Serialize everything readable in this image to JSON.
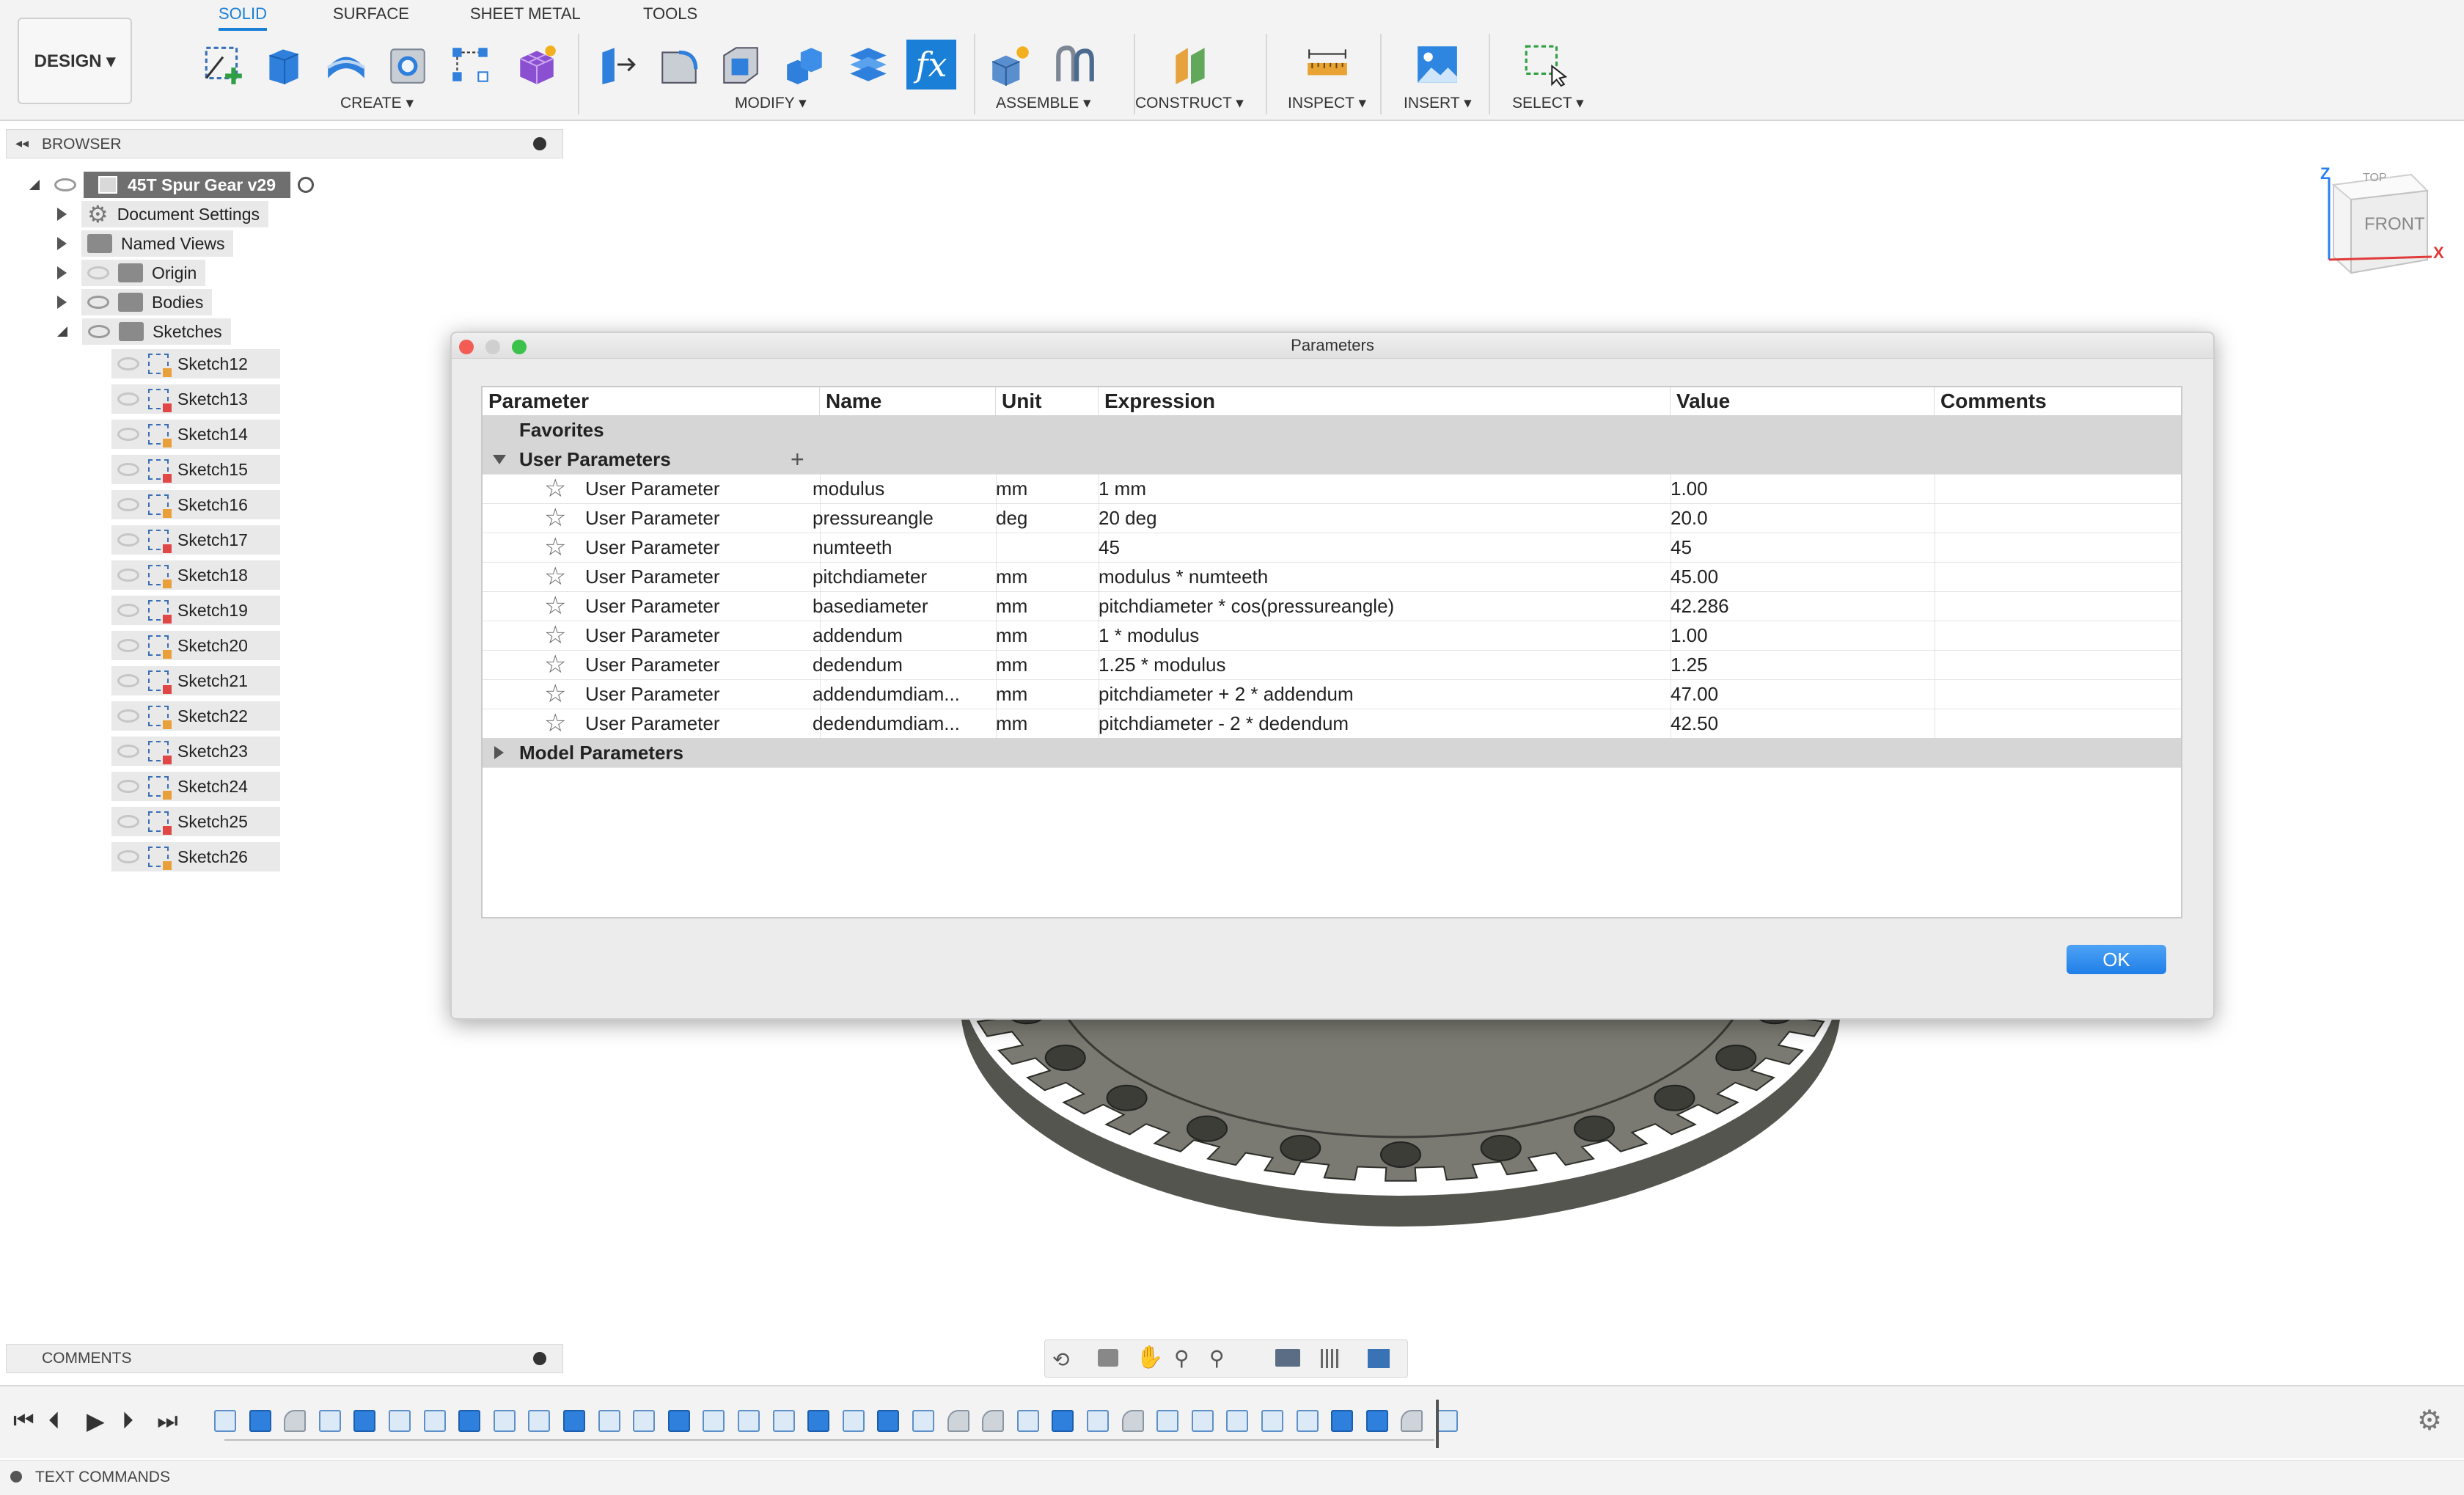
{
  "toolbar": {
    "workspace_button": "DESIGN ▾",
    "tabs": [
      "SOLID",
      "SURFACE",
      "SHEET METAL",
      "TOOLS"
    ],
    "groups": [
      "CREATE ▾",
      "MODIFY ▾",
      "ASSEMBLE ▾",
      "CONSTRUCT ▾",
      "INSPECT ▾",
      "INSERT ▾",
      "SELECT ▾"
    ],
    "fx_label": "fx"
  },
  "browser": {
    "title": "BROWSER",
    "root": "45T Spur Gear v29",
    "items": [
      "Document Settings",
      "Named Views",
      "Origin",
      "Bodies",
      "Sketches"
    ],
    "sketches": [
      "Sketch12",
      "Sketch13",
      "Sketch14",
      "Sketch15",
      "Sketch16",
      "Sketch17",
      "Sketch18",
      "Sketch19",
      "Sketch20",
      "Sketch21",
      "Sketch22",
      "Sketch23",
      "Sketch24",
      "Sketch25",
      "Sketch26"
    ]
  },
  "viewcube": {
    "top": "TOP",
    "front": "FRONT",
    "z": "Z",
    "x": "X"
  },
  "dialog": {
    "title": "Parameters",
    "columns": [
      "Parameter",
      "Name",
      "Unit",
      "Expression",
      "Value",
      "Comments"
    ],
    "sections": {
      "favorites": "Favorites",
      "user": "User Parameters",
      "model": "Model Parameters"
    },
    "add_symbol": "+",
    "rows": [
      {
        "param": "User Parameter",
        "name": "modulus",
        "unit": "mm",
        "expression": "1 mm",
        "value": "1.00"
      },
      {
        "param": "User Parameter",
        "name": "pressureangle",
        "unit": "deg",
        "expression": "20 deg",
        "value": "20.0"
      },
      {
        "param": "User Parameter",
        "name": "numteeth",
        "unit": "",
        "expression": "45",
        "value": "45"
      },
      {
        "param": "User Parameter",
        "name": "pitchdiameter",
        "unit": "mm",
        "expression": "modulus * numteeth",
        "value": "45.00"
      },
      {
        "param": "User Parameter",
        "name": "basediameter",
        "unit": "mm",
        "expression": "pitchdiameter * cos(pressureangle)",
        "value": "42.286"
      },
      {
        "param": "User Parameter",
        "name": "addendum",
        "unit": "mm",
        "expression": "1 * modulus",
        "value": "1.00"
      },
      {
        "param": "User Parameter",
        "name": "dedendum",
        "unit": "mm",
        "expression": "1.25 * modulus",
        "value": "1.25"
      },
      {
        "param": "User Parameter",
        "name": "addendumdiam...",
        "unit": "mm",
        "expression": "pitchdiameter + 2 * addendum",
        "value": "47.00"
      },
      {
        "param": "User Parameter",
        "name": "dedendumdiam...",
        "unit": "mm",
        "expression": "pitchdiameter - 2 * dedendum",
        "value": "42.50"
      }
    ],
    "ok": "OK"
  },
  "bottom": {
    "comments": "COMMENTS",
    "text_commands": "TEXT COMMANDS"
  },
  "colors": {
    "accent": "#1a7fd6",
    "fx_bg": "#1a7fd6",
    "ok_button": "#2a86ec",
    "gear": "#7a7a72"
  }
}
